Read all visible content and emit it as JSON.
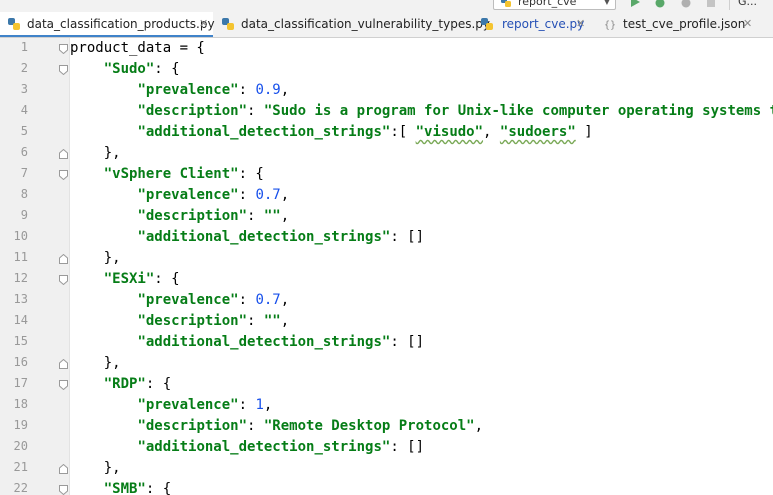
{
  "toolbar": {
    "run_config": "report_cve",
    "extra": "G..."
  },
  "tabs": [
    {
      "label": "data_classification_products.py",
      "active": true
    },
    {
      "label": "data_classification_vulnerability_types.py",
      "active": false
    },
    {
      "label": "report_cve.py",
      "active": false
    },
    {
      "label": "test_cve_profile.json",
      "active": false
    }
  ],
  "lines": [
    {
      "n": "1",
      "parts": [
        [
          "",
          "product_data = {"
        ]
      ]
    },
    {
      "n": "2",
      "parts": [
        [
          "",
          "    "
        ],
        [
          "s",
          "\"Sudo\""
        ],
        [
          "",
          ": {"
        ]
      ]
    },
    {
      "n": "3",
      "parts": [
        [
          "",
          "        "
        ],
        [
          "s",
          "\"prevalence\""
        ],
        [
          "",
          ": "
        ],
        [
          "n",
          "0.9"
        ],
        [
          "",
          ","
        ]
      ]
    },
    {
      "n": "4",
      "parts": [
        [
          "",
          "        "
        ],
        [
          "s",
          "\"description\""
        ],
        [
          "",
          ": "
        ],
        [
          "s",
          "\"Sudo is a program for Unix-like computer operating systems that"
        ]
      ]
    },
    {
      "n": "5",
      "parts": [
        [
          "",
          "        "
        ],
        [
          "s",
          "\"additional_detection_strings\""
        ],
        [
          "",
          ":[ "
        ],
        [
          "s",
          "\"visudo\""
        ],
        [
          "",
          ", "
        ],
        [
          "s",
          "\"sudoers\""
        ],
        [
          "",
          " ]"
        ]
      ]
    },
    {
      "n": "6",
      "parts": [
        [
          "",
          "    },"
        ]
      ]
    },
    {
      "n": "7",
      "parts": [
        [
          "",
          "    "
        ],
        [
          "s",
          "\"vSphere Client\""
        ],
        [
          "",
          ": {"
        ]
      ]
    },
    {
      "n": "8",
      "parts": [
        [
          "",
          "        "
        ],
        [
          "s",
          "\"prevalence\""
        ],
        [
          "",
          ": "
        ],
        [
          "n",
          "0.7"
        ],
        [
          "",
          ","
        ]
      ]
    },
    {
      "n": "9",
      "parts": [
        [
          "",
          "        "
        ],
        [
          "s",
          "\"description\""
        ],
        [
          "",
          ": "
        ],
        [
          "s",
          "\"\""
        ],
        [
          "",
          ","
        ]
      ]
    },
    {
      "n": "10",
      "parts": [
        [
          "",
          "        "
        ],
        [
          "s",
          "\"additional_detection_strings\""
        ],
        [
          "",
          ": []"
        ]
      ]
    },
    {
      "n": "11",
      "parts": [
        [
          "",
          "    },"
        ]
      ]
    },
    {
      "n": "12",
      "parts": [
        [
          "",
          "    "
        ],
        [
          "s",
          "\"ESXi\""
        ],
        [
          "",
          ": {"
        ]
      ]
    },
    {
      "n": "13",
      "parts": [
        [
          "",
          "        "
        ],
        [
          "s",
          "\"prevalence\""
        ],
        [
          "",
          ": "
        ],
        [
          "n",
          "0.7"
        ],
        [
          "",
          ","
        ]
      ]
    },
    {
      "n": "14",
      "parts": [
        [
          "",
          "        "
        ],
        [
          "s",
          "\"description\""
        ],
        [
          "",
          ": "
        ],
        [
          "s",
          "\"\""
        ],
        [
          "",
          ","
        ]
      ]
    },
    {
      "n": "15",
      "parts": [
        [
          "",
          "        "
        ],
        [
          "s",
          "\"additional_detection_strings\""
        ],
        [
          "",
          ": []"
        ]
      ]
    },
    {
      "n": "16",
      "parts": [
        [
          "",
          "    },"
        ]
      ]
    },
    {
      "n": "17",
      "parts": [
        [
          "",
          "    "
        ],
        [
          "s",
          "\"RDP\""
        ],
        [
          "",
          ": {"
        ]
      ]
    },
    {
      "n": "18",
      "parts": [
        [
          "",
          "        "
        ],
        [
          "s",
          "\"prevalence\""
        ],
        [
          "",
          ": "
        ],
        [
          "n",
          "1"
        ],
        [
          "",
          ","
        ]
      ]
    },
    {
      "n": "19",
      "parts": [
        [
          "",
          "        "
        ],
        [
          "s",
          "\"description\""
        ],
        [
          "",
          ": "
        ],
        [
          "s",
          "\"Remote Desktop Protocol\""
        ],
        [
          "",
          ","
        ]
      ]
    },
    {
      "n": "20",
      "parts": [
        [
          "",
          "        "
        ],
        [
          "s",
          "\"additional_detection_strings\""
        ],
        [
          "",
          ": []"
        ]
      ]
    },
    {
      "n": "21",
      "parts": [
        [
          "",
          "    },"
        ]
      ]
    },
    {
      "n": "22",
      "parts": [
        [
          "",
          "    "
        ],
        [
          "s",
          "\"SMB\""
        ],
        [
          "",
          ": {"
        ]
      ]
    }
  ],
  "colors": {
    "string": "#067d17",
    "number": "#1750eb",
    "active_tab_underline": "#4083c9"
  }
}
